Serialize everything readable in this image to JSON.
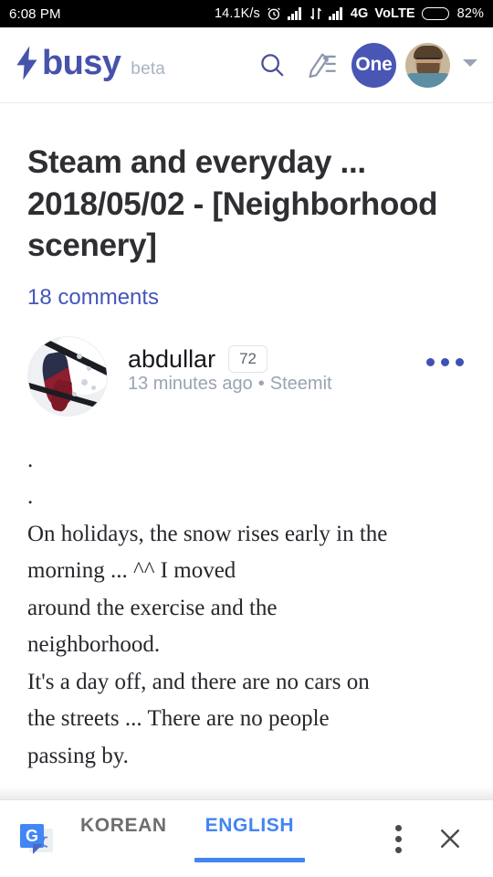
{
  "statusbar": {
    "time": "6:08 PM",
    "network_speed": "14.1K/s",
    "network_type": "4G",
    "volte": "VoLTE",
    "battery_percent": "82%",
    "alarm_icon": "alarm-clock-icon",
    "signal_icon": "signal-bars-icon",
    "data_icon": "data-transfer-icon",
    "battery_icon": "battery-icon"
  },
  "header": {
    "logo_text": "busy",
    "logo_icon": "lightning-bolt-icon",
    "beta_label": "beta",
    "search_icon": "search-icon",
    "write_icon": "compose-pencil-icon",
    "badge_label": "One",
    "avatar_icon": "user-avatar",
    "caret_icon": "chevron-down-icon",
    "accent_color": "#4653ab"
  },
  "post": {
    "title": "Steam and everyday ... 2018/05/02 - [Neighborhood scenery]",
    "comments_label": "18 comments",
    "comments_color": "#4455bb",
    "author": {
      "name": "abdullar",
      "reputation": "72",
      "timestamp": "13 minutes ago",
      "separator": "•",
      "source": "Steemit",
      "avatar_icon": "author-avatar",
      "menu_icon": "more-options-icon"
    },
    "body_lines": [
      ".",
      ".",
      "On holidays, the snow rises early in the",
      "morning ... ^^ I moved",
      "around the exercise and the",
      "neighborhood.",
      "It's a day off, and there are no cars on",
      "the streets ... There are no people",
      "passing by."
    ]
  },
  "translate_bar": {
    "app_icon": "google-translate-icon",
    "icon_letter": "G",
    "icon_glyph": "文",
    "source_language": "KOREAN",
    "target_language": "ENGLISH",
    "active_language": "ENGLISH",
    "active_color": "#4285f4",
    "menu_icon": "overflow-menu-icon",
    "close_icon": "close-icon"
  }
}
